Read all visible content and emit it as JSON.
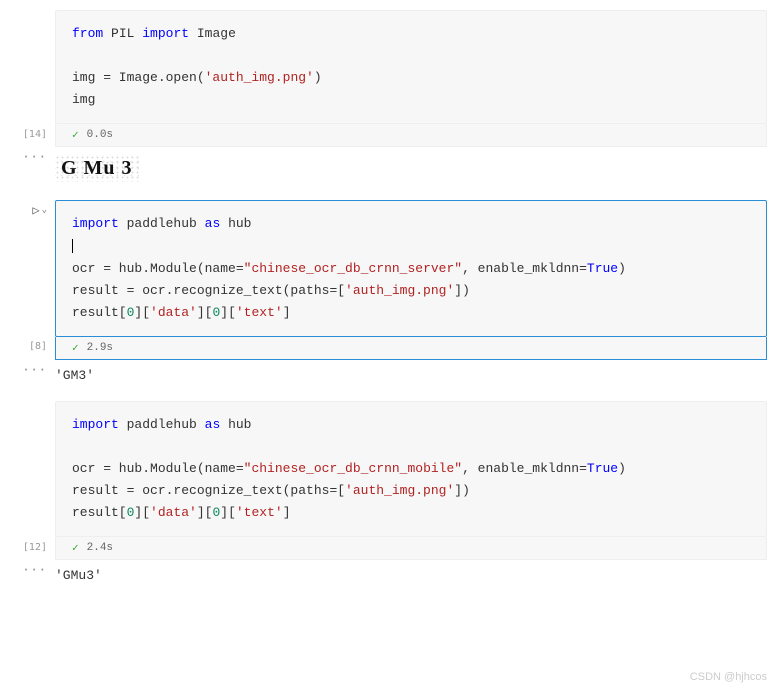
{
  "cells": [
    {
      "exec_label": "[14]",
      "time": "0.0s",
      "code": {
        "line1": {
          "from": "from",
          "mod": "PIL",
          "import": "import",
          "name": "Image"
        },
        "line3": {
          "assign": "img = Image.open(",
          "str": "'auth_img.png'",
          "close": ")"
        },
        "line4": {
          "expr": "img"
        }
      },
      "output": "G Mu 3"
    },
    {
      "exec_label": "[8]",
      "time": "2.9s",
      "gutter_icon": "▷",
      "code": {
        "line1": {
          "import": "import",
          "mod": "paddlehub",
          "as": "as",
          "alias": "hub"
        },
        "line3a": {
          "pre": "ocr = hub.Module(name=",
          "str": "\"chinese_ocr_db_crnn_server\"",
          "mid": ", enable_mkldnn=",
          "const": "True",
          "close": ")"
        },
        "line4": {
          "pre": "result = ocr.recognize_text(paths=[",
          "str": "'auth_img.png'",
          "close": "])"
        },
        "line5": {
          "pre": "result[",
          "n0": "0",
          "mid1": "][",
          "str1": "'data'",
          "mid2": "][",
          "n1": "0",
          "mid3": "][",
          "str2": "'text'",
          "close": "]"
        }
      },
      "output": "'GM3'"
    },
    {
      "exec_label": "[12]",
      "time": "2.4s",
      "code": {
        "line1": {
          "import": "import",
          "mod": "paddlehub",
          "as": "as",
          "alias": "hub"
        },
        "line3a": {
          "pre": "ocr = hub.Module(name=",
          "str": "\"chinese_ocr_db_crnn_mobile\"",
          "mid": ", enable_mkldnn=",
          "const": "True",
          "close": ")"
        },
        "line4": {
          "pre": "result = ocr.recognize_text(paths=[",
          "str": "'auth_img.png'",
          "close": "])"
        },
        "line5": {
          "pre": "result[",
          "n0": "0",
          "mid1": "][",
          "str1": "'data'",
          "mid2": "][",
          "n1": "0",
          "mid3": "][",
          "str2": "'text'",
          "close": "]"
        }
      },
      "output": "'GMu3'"
    }
  ],
  "dots": "···",
  "check": "✓",
  "watermark": "CSDN @hjhcos"
}
